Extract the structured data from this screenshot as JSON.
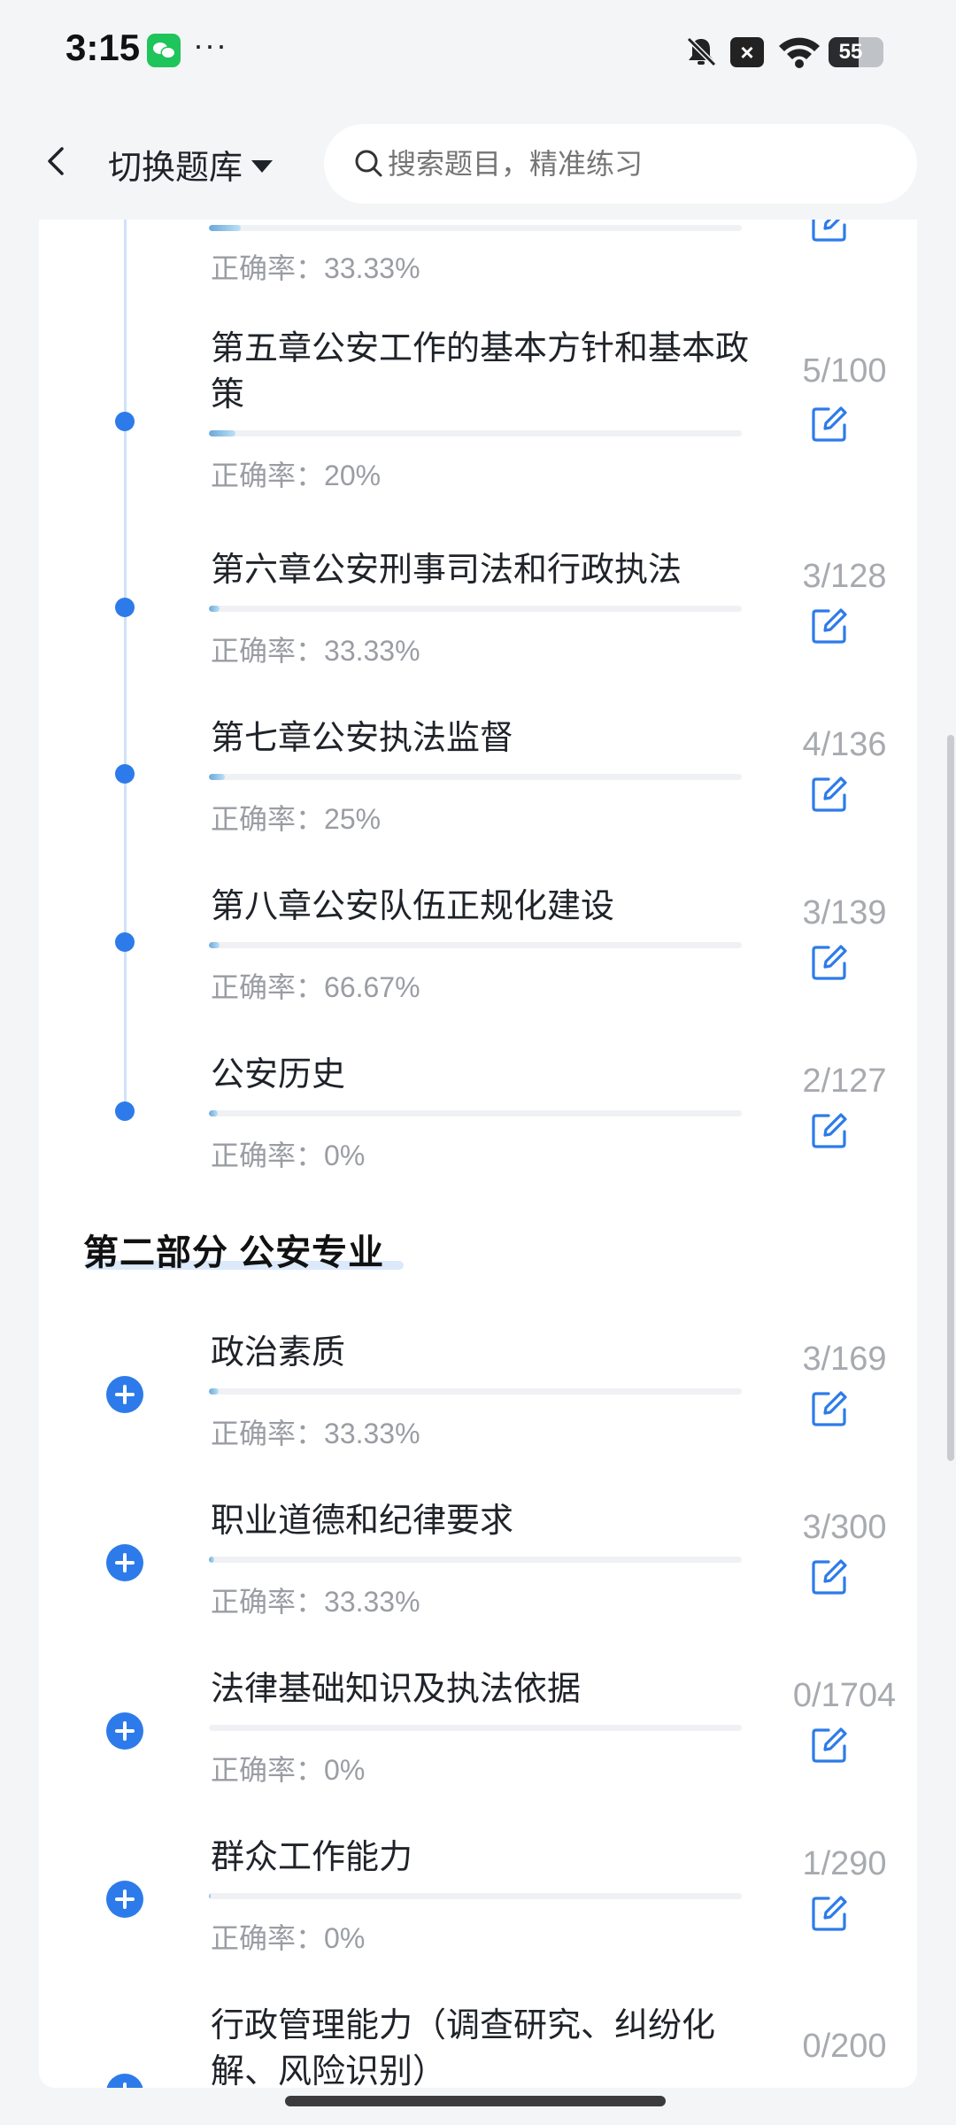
{
  "status": {
    "time": "3:15",
    "more": "···",
    "battery": "55"
  },
  "header": {
    "bank_switch_label": "切换题库",
    "search_placeholder": "搜索题目，精准练习"
  },
  "accuracy_prefix": "正确率：",
  "partial_top": {
    "accuracy": "33.33%",
    "progress": 0.06
  },
  "part_one_items": [
    {
      "title": "第五章公安工作的基本方针和基本政策",
      "count": "5/100",
      "accuracy": "20%",
      "progress": 0.05
    },
    {
      "title": "第六章公安刑事司法和行政执法",
      "count": "3/128",
      "accuracy": "33.33%",
      "progress": 0.02
    },
    {
      "title": "第七章公安执法监督",
      "count": "4/136",
      "accuracy": "25%",
      "progress": 0.03
    },
    {
      "title": "第八章公安队伍正规化建设",
      "count": "3/139",
      "accuracy": "66.67%",
      "progress": 0.02
    },
    {
      "title": "公安历史",
      "count": "2/127",
      "accuracy": "0%",
      "progress": 0.016
    }
  ],
  "section_two": {
    "title": "第二部分 公安专业"
  },
  "part_two_items": [
    {
      "title": "政治素质",
      "count": "3/169",
      "accuracy": "33.33%",
      "progress": 0.018
    },
    {
      "title": "职业道德和纪律要求",
      "count": "3/300",
      "accuracy": "33.33%",
      "progress": 0.01
    },
    {
      "title": "法律基础知识及执法依据",
      "count": "0/1704",
      "accuracy": "0%",
      "progress": 0
    },
    {
      "title": "群众工作能力",
      "count": "1/290",
      "accuracy": "0%",
      "progress": 0.004
    },
    {
      "title": "行政管理能力（调查研究、纠纷化解、风险识别）",
      "count": "0/200",
      "accuracy": "",
      "progress": 0
    }
  ]
}
